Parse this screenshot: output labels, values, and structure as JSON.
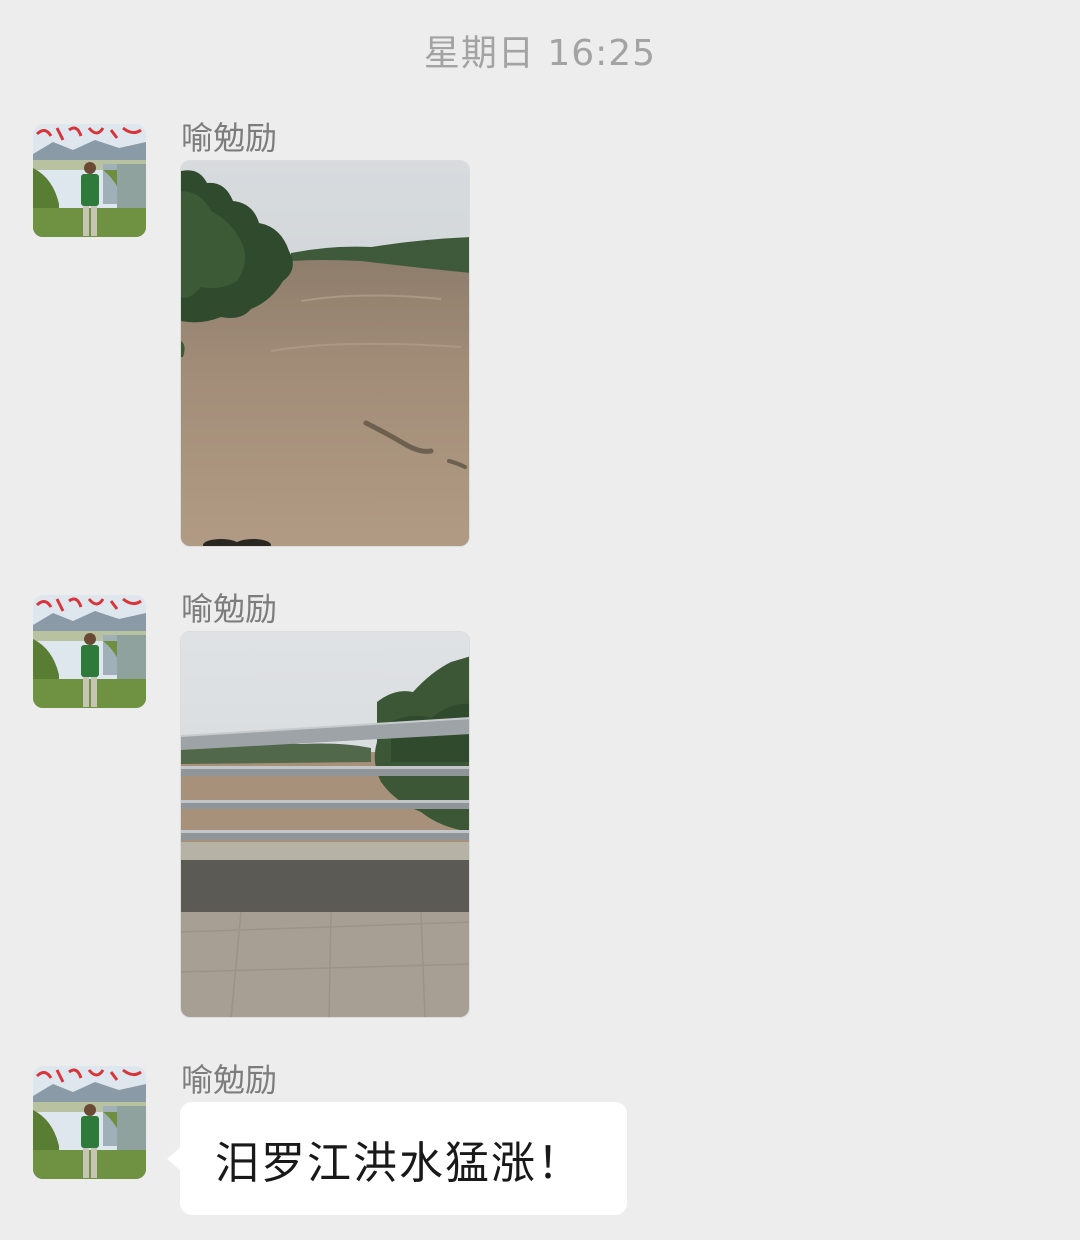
{
  "chat": {
    "timestamp": "星期日 16:25",
    "messages": [
      {
        "sender": "喻勉励",
        "type": "image",
        "image_description_icon": "flooded-river-photo"
      },
      {
        "sender": "喻勉励",
        "type": "image",
        "image_description_icon": "bridge-railing-flood-photo"
      },
      {
        "sender": "喻勉励",
        "type": "text",
        "text": "汨罗江洪水猛涨！"
      }
    ]
  },
  "colors": {
    "background": "#ededed",
    "bubble": "#ffffff",
    "timestamp": "#a3a3a3",
    "sender_name": "#7d7d7d",
    "message_text": "#191919"
  }
}
